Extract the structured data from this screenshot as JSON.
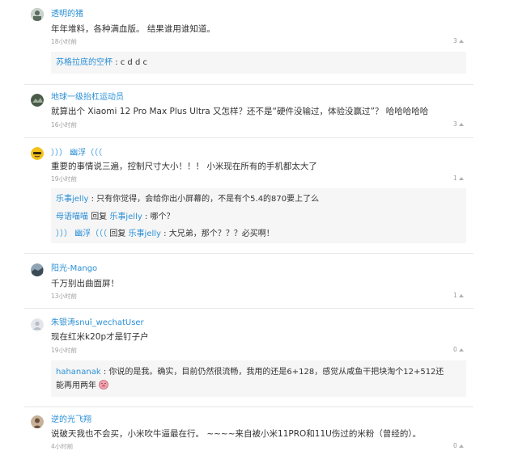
{
  "comments": [
    {
      "user": "透明的猪",
      "text": "年年堆料，各种满血版。 结果谁用谁知道。",
      "time": "18小时前",
      "likes": "3",
      "replies": [
        {
          "user": "苏格拉底的空杯",
          "sep": ":",
          "text": "c d d c"
        }
      ]
    },
    {
      "user": "地球一级抬杠运动员",
      "text": "就算出个 Xiaomi 12 Pro Max Plus Ultra 又怎样？还不是“硬件没输过，体验没赢过”？ 哈哈哈哈哈",
      "time": "16小时前",
      "likes": "3"
    },
    {
      "user": "））） 幽浮（（（",
      "text": "重要的事情说三遍，控制尺寸大小！！！ 小米现在所有的手机都太大了",
      "time": "19小时前",
      "likes": "1",
      "replies": [
        {
          "user": "乐事jelly",
          "sep": ":",
          "text": "只有你觉得，会给你出小屏幕的，不是有个5.4的870要上了么"
        },
        {
          "user": "母语喵喵",
          "mid": "回复",
          "target": "乐事jelly",
          "sep": ":",
          "text": "哪个？"
        },
        {
          "user": "））） 幽浮（（（",
          "mid": "回复",
          "target": "乐事jelly",
          "sep": ":",
          "text": "大兄弟，那个？？？必买啊！"
        }
      ]
    },
    {
      "user": "阳光-Mango",
      "text": "千万别出曲面屏！",
      "time": "13小时前",
      "likes": "1"
    },
    {
      "user": "朱银涛snuǐ_wechatUser",
      "text": "现在红米k20p才是钉子户",
      "time": "19小时前",
      "likes": "0",
      "replies": [
        {
          "user": "hahananak",
          "sep": ":",
          "text": "你说的是我。确实，目前仍然很流畅，我用的还是6+128，感觉从咸鱼干把块淘个12+512还",
          "text2": "能再用两年"
        }
      ]
    },
    {
      "user": "逆的光飞翔",
      "text": "说破天我也不会买，小米吹牛逼最在行。 ~~~~来自被小米11PRO和11U伤过的米粉（曾经的）。",
      "time": "4小时前",
      "likes": "0"
    }
  ]
}
